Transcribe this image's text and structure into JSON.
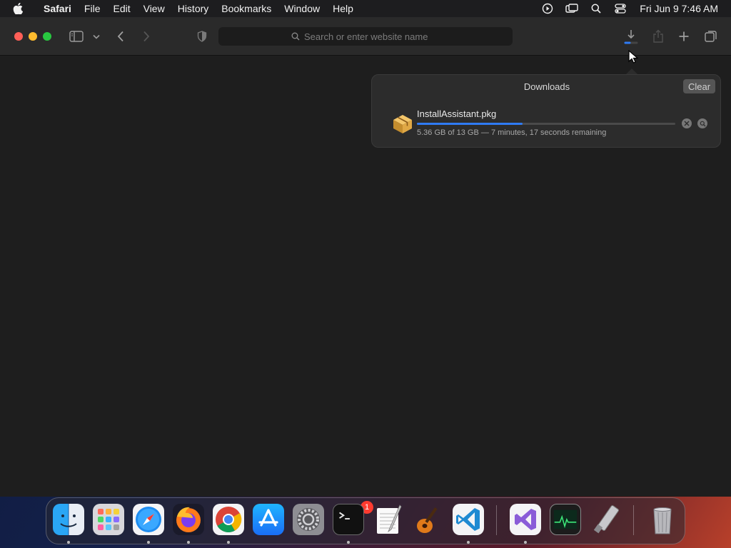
{
  "menubar": {
    "items": [
      "Safari",
      "File",
      "Edit",
      "View",
      "History",
      "Bookmarks",
      "Window",
      "Help"
    ],
    "clock": "Fri Jun 9  7:46 AM"
  },
  "toolbar": {
    "search_placeholder": "Search or enter website name"
  },
  "downloads": {
    "title": "Downloads",
    "clear_label": "Clear",
    "item": {
      "filename": "InstallAssistant.pkg",
      "status": "5.36 GB of 13 GB — 7 minutes, 17 seconds remaining",
      "progress": 0.41
    }
  },
  "dock": {
    "settings_badge": "1",
    "apps": [
      "Finder",
      "Launchpad",
      "Safari",
      "Firefox",
      "Chrome",
      "App Store",
      "System Settings",
      "Terminal",
      "TextEdit",
      "GarageBand",
      "Visual Studio Code",
      "Visual Studio",
      "Activity Monitor",
      "Installer",
      "Trash"
    ]
  },
  "colors": {
    "accent": "#2f7bf5",
    "window_bg": "#1e1e1e",
    "toolbar_bg": "#2a2a2a",
    "badge": "#ff3b30"
  }
}
